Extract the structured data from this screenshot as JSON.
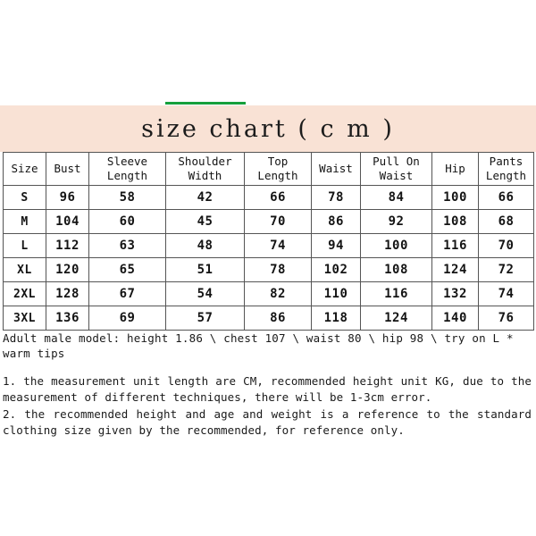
{
  "banner": {
    "title": "size chart ( c m )",
    "background_color": "#f9e2d5",
    "accent_rule_color": "#16a03c"
  },
  "chart_data": {
    "type": "table",
    "title": "size chart ( c m )",
    "columns": [
      "Size",
      "Bust",
      "Sleeve Length",
      "Shoulder Width",
      "Top Length",
      "Waist",
      "Pull On Waist",
      "Hip",
      "Pants Length"
    ],
    "column_labels_wrapped": [
      [
        "Size"
      ],
      [
        "Bust"
      ],
      [
        "Sleeve",
        "Length"
      ],
      [
        "Shoulder",
        "Width"
      ],
      [
        "Top",
        "Length"
      ],
      [
        "Waist"
      ],
      [
        "Pull On",
        "Waist"
      ],
      [
        "Hip"
      ],
      [
        "Pants",
        "Length"
      ]
    ],
    "rows": [
      [
        "S",
        "96",
        "58",
        "42",
        "66",
        "78",
        "84",
        "100",
        "66"
      ],
      [
        "M",
        "104",
        "60",
        "45",
        "70",
        "86",
        "92",
        "108",
        "68"
      ],
      [
        "L",
        "112",
        "63",
        "48",
        "74",
        "94",
        "100",
        "116",
        "70"
      ],
      [
        "XL",
        "120",
        "65",
        "51",
        "78",
        "102",
        "108",
        "124",
        "72"
      ],
      [
        "2XL",
        "128",
        "67",
        "54",
        "82",
        "110",
        "116",
        "132",
        "74"
      ],
      [
        "3XL",
        "136",
        "69",
        "57",
        "86",
        "118",
        "124",
        "140",
        "76"
      ]
    ],
    "unit": "cm"
  },
  "model_note": "Adult male model: height 1.86 \\ chest 107 \\ waist 80 \\ hip 98 \\ try on L * warm tips",
  "notes": [
    "1. the measurement unit length are CM, recommended height unit KG, due to the measurement of different techniques, there will be 1-3cm error.",
    "2. the recommended height and age and weight is a reference to the standard clothing size given by the recommended, for reference only."
  ]
}
